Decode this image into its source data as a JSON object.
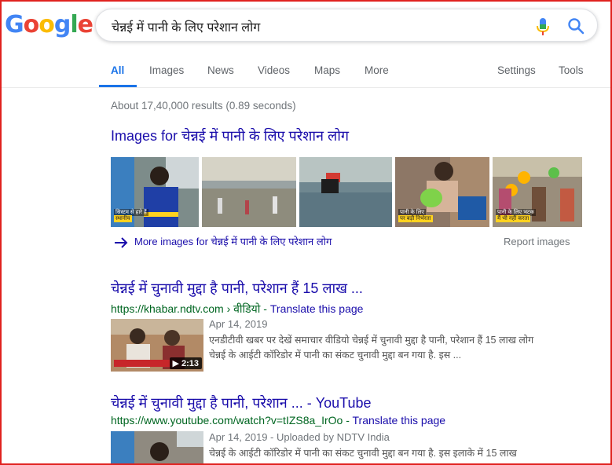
{
  "logo": {
    "letters": [
      "G",
      "o",
      "o",
      "g",
      "l",
      "e"
    ],
    "colors": [
      "#4285f4",
      "#ea4335",
      "#fbbc05",
      "#4285f4",
      "#34a853",
      "#ea4335"
    ]
  },
  "search": {
    "query": "चेन्नई में पानी के लिए परेशान लोग",
    "mic_icon": "microphone-icon",
    "search_icon": "search-icon"
  },
  "tabs": {
    "all": "All",
    "images": "Images",
    "news": "News",
    "videos": "Videos",
    "maps": "Maps",
    "more": "More",
    "settings": "Settings",
    "tools": "Tools"
  },
  "result_stats": "About 17,40,000 results (0.89 seconds)",
  "images_block": {
    "heading": "Images for चेन्नई में पानी के लिए परेशान लोग",
    "more_link": "More images for चेन्नई में पानी के लिए परेशान लोग",
    "report": "Report images",
    "thumbs": [
      {
        "caption_top": "सिस्टम से हारे हैं",
        "caption": "स्थानीय"
      },
      {
        "caption_top": "",
        "caption": ""
      },
      {
        "caption_top": "",
        "caption": ""
      },
      {
        "caption_top": "पानी के लिए",
        "caption": "पर बड़ी निर्भरता"
      },
      {
        "caption_top": "पानी के लिए भटक",
        "caption": "मैं भी नहीं करता"
      }
    ]
  },
  "results": [
    {
      "title": "चेन्नई में चुनावी मुद्दा है पानी, परेशान हैं 15 लाख ...",
      "url": "https://khabar.ndtv.com › वीडियो - ",
      "translate": "Translate this page",
      "date": "Apr 14, 2019",
      "snippet_1": "एनडीटीवी खबर पर देखें समाचार वीडियो चेन्नई में चुनावी मुद्दा है पानी, परेशान हैं 15 लाख लोग",
      "snippet_2": "चेन्नई के आईटी कॉरिडोर में पानी का संकट चुनावी मुद्दा बन गया है. इस ...",
      "duration": "▶ 2:13"
    },
    {
      "title": "चेन्नई में चुनावी मुद्दा है पानी, परेशान ... - YouTube",
      "url": "https://www.youtube.com/watch?v=tIZS8a_IrOo - ",
      "translate": "Translate this page",
      "date": "Apr 14, 2019 - Uploaded by NDTV India",
      "snippet_1": "चेन्नई के आईटी कॉरिडोर में पानी का संकट चुनावी मुद्दा बन गया है. इस इलाके में 15 लाख"
    }
  ],
  "colors": {
    "link": "#1a0dab",
    "url": "#006621",
    "accent": "#1a73e8",
    "frame": "#e0221f"
  }
}
